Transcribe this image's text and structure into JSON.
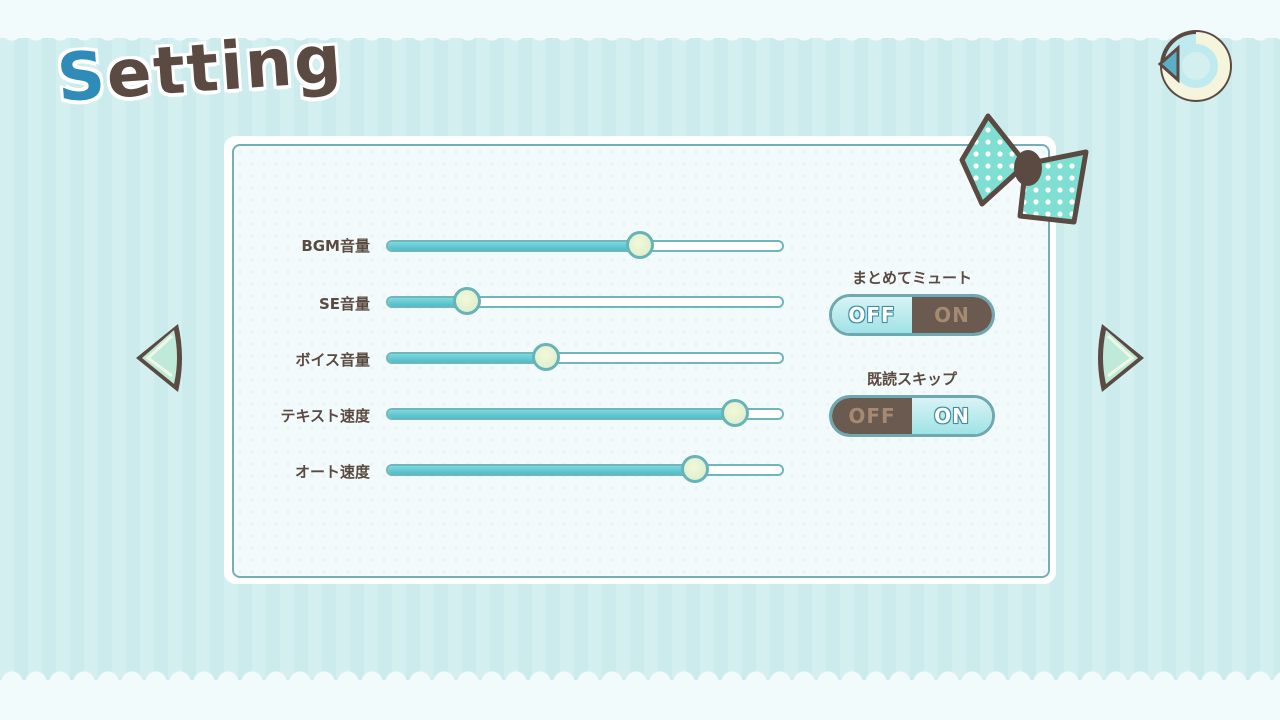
{
  "title": {
    "first": "S",
    "rest": "etting"
  },
  "back_button": {
    "icon": "return-arrow-icon"
  },
  "sliders": [
    {
      "label": "BGM音量",
      "value": 0.64
    },
    {
      "label": "SE音量",
      "value": 0.2
    },
    {
      "label": "ボイス音量",
      "value": 0.4
    },
    {
      "label": "テキスト速度",
      "value": 0.88
    },
    {
      "label": "オート速度",
      "value": 0.78
    }
  ],
  "toggles": [
    {
      "label": "まとめてミュート",
      "off": "OFF",
      "on": "ON",
      "selected": "OFF"
    },
    {
      "label": "既読スキップ",
      "off": "OFF",
      "on": "ON",
      "selected": "ON"
    }
  ],
  "nav": {
    "prev_icon": "left-arrow-icon",
    "next_icon": "right-arrow-icon"
  },
  "colors": {
    "background": "#d4eff0",
    "accent": "#52bcc5",
    "brown": "#5a4a42",
    "title_blue": "#2f8bb8"
  }
}
